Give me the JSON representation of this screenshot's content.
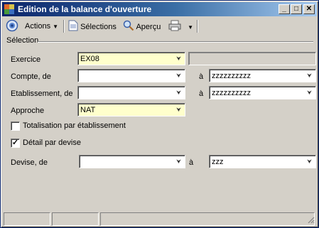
{
  "window": {
    "title": "Edition de la balance d'ouverture"
  },
  "toolbar": {
    "actions_label": "Actions",
    "selections_label": "Sélections",
    "preview_label": "Aperçu"
  },
  "section": {
    "label": "Sélection"
  },
  "form": {
    "exercice": {
      "label": "Exercice",
      "value": "EX08"
    },
    "compte": {
      "label": "Compte, de",
      "from": "",
      "to_label": "à",
      "to": "zzzzzzzzzz"
    },
    "etablissement": {
      "label": "Etablissement, de",
      "from": "",
      "to_label": "à",
      "to": "zzzzzzzzzz"
    },
    "approche": {
      "label": "Approche",
      "value": "NAT"
    },
    "totalisation": {
      "label": "Totalisation par établissement",
      "checked": false
    },
    "detail": {
      "label": "Détail par devise",
      "checked": true
    },
    "devise": {
      "label": "Devise, de",
      "from": "",
      "to_label": "à",
      "to": "zzz"
    }
  }
}
